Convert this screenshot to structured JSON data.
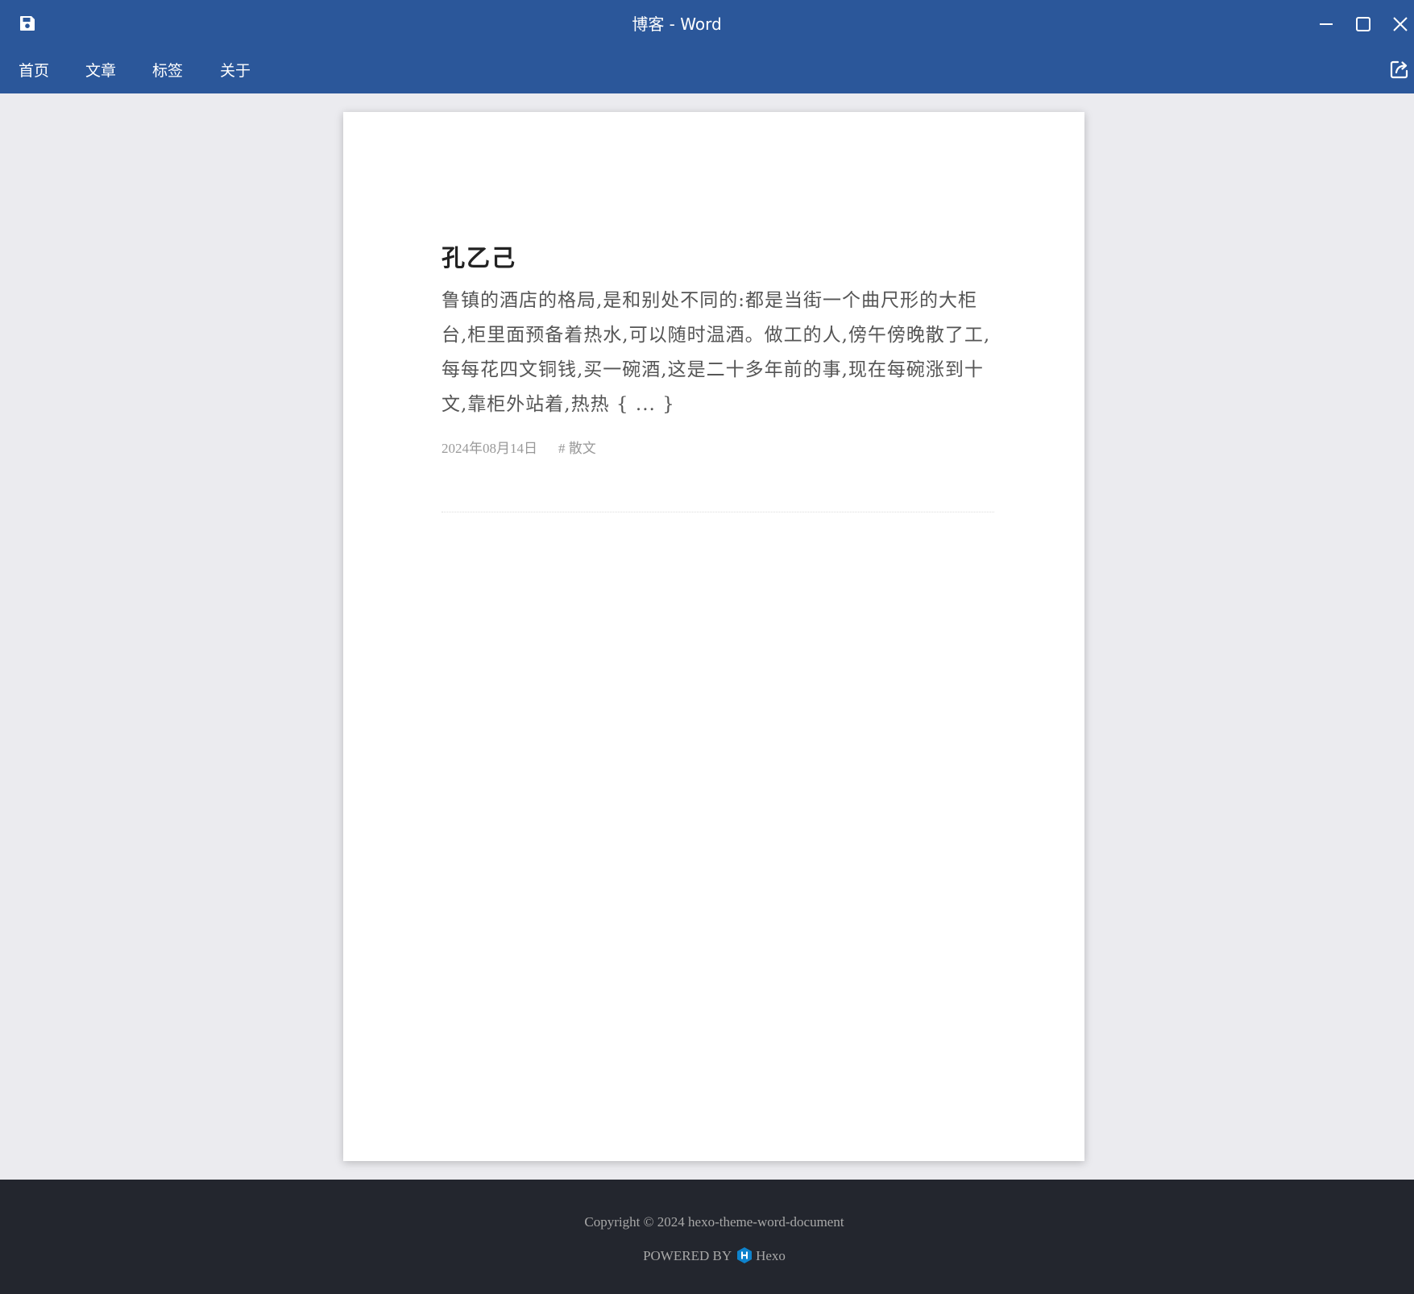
{
  "window": {
    "title": "博客 - Word"
  },
  "nav": {
    "items": [
      {
        "label": "首页"
      },
      {
        "label": "文章"
      },
      {
        "label": "标签"
      },
      {
        "label": "关于"
      }
    ]
  },
  "icons": {
    "save": "save-icon",
    "minimize": "minimize-icon",
    "maximize": "maximize-icon",
    "close": "close-icon",
    "share": "share-icon",
    "hexo_logo": "hexo-logo-icon"
  },
  "post": {
    "title": "孔乙己",
    "excerpt": "鲁镇的酒店的格局,是和别处不同的:都是当街一个曲尺形的大柜台,柜里面预备着热水,可以随时温酒。做工的人,傍午傍晚散了工,每每花四文铜钱,买一碗酒,这是二十多年前的事,现在每碗涨到十文,靠柜外站着,热热 { ... }",
    "date": "2024年08月14日",
    "tag": "# 散文"
  },
  "footer": {
    "copyright": "Copyright © 2024 hexo-theme-word-document",
    "powered_by": "POWERED BY",
    "hexo_label": "Hexo"
  },
  "colors": {
    "header_bg": "#2b579a",
    "canvas_bg": "#ebebef",
    "footer_bg": "#23262e",
    "hexo_blue": "#0e83cd"
  }
}
